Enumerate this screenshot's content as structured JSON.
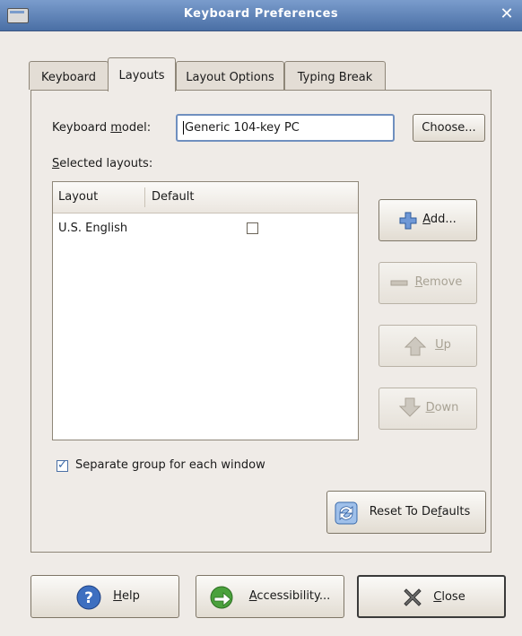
{
  "window": {
    "title": "Keyboard Preferences"
  },
  "tabs": [
    {
      "label": "Keyboard"
    },
    {
      "label": "Layouts"
    },
    {
      "label": "Layout Options"
    },
    {
      "label": "Typing Break"
    }
  ],
  "layouts": {
    "model_label_pre": "Keyboard ",
    "model_label_key": "m",
    "model_label_post": "odel:",
    "model_value": "Generic 104-key PC",
    "choose_label": "Choose...",
    "selected_label_key": "S",
    "selected_label_post": "elected layouts:",
    "columns": {
      "layout": "Layout",
      "default": "Default"
    },
    "rows": [
      {
        "layout": "U.S. English",
        "default": false
      }
    ],
    "add": {
      "key": "A",
      "rest": "dd..."
    },
    "remove": {
      "key": "R",
      "rest": "emove"
    },
    "up": {
      "key": "U",
      "rest": "p"
    },
    "down": {
      "key": "D",
      "rest": "own"
    },
    "separate_group_label": "Separate group for each window",
    "separate_group_checked": true,
    "reset": {
      "pre": "Reset To De",
      "key": "f",
      "post": "aults"
    }
  },
  "footer": {
    "help": {
      "key": "H",
      "rest": "elp"
    },
    "accessibility": {
      "key": "A",
      "rest": "ccessibility..."
    },
    "close": {
      "key": "C",
      "rest": "lose"
    }
  }
}
